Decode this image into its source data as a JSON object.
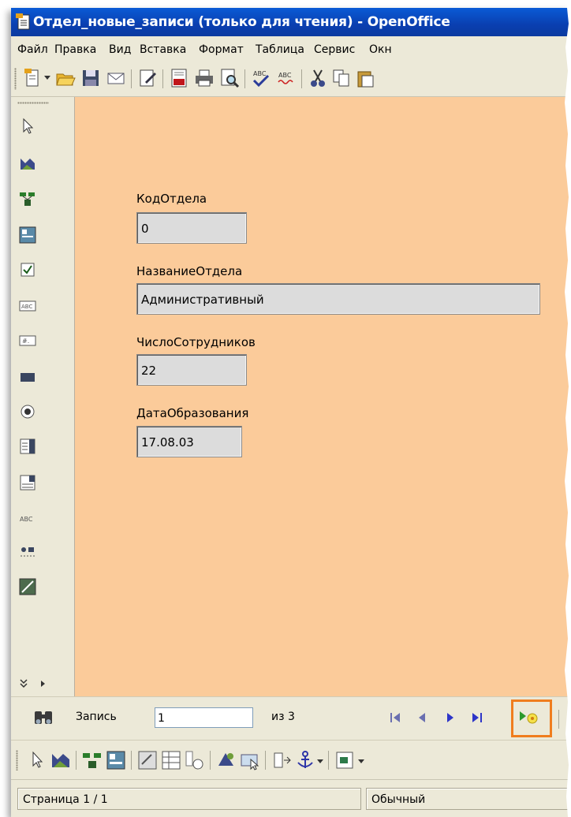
{
  "window": {
    "title": "Отдел_новые_записи (только для чтения) - OpenOffice"
  },
  "menu": {
    "items": [
      "Файл",
      "Правка",
      "Вид",
      "Вставка",
      "Формат",
      "Таблица",
      "Сервис",
      "Окн"
    ]
  },
  "toolbar": {
    "icons": [
      "new-document-icon",
      "open-folder-icon",
      "save-icon",
      "email-icon",
      "edit-file-icon",
      "export-pdf-icon",
      "print-icon",
      "print-preview-icon",
      "spellcheck-icon",
      "autospellcheck-icon",
      "cut-icon",
      "copy-icon",
      "paste-icon"
    ]
  },
  "form": {
    "fields": [
      {
        "label": "КодОтдела",
        "value": "0"
      },
      {
        "label": "НазваниеОтдела",
        "value": "Административный"
      },
      {
        "label": "ЧислоСотрудников",
        "value": "22"
      },
      {
        "label": "ДатаОбразования",
        "value": "17.08.03"
      }
    ]
  },
  "navigation": {
    "record_label": "Запись",
    "record_value": "1",
    "of_label": "из 3"
  },
  "statusbar": {
    "page": "Страница  1 / 1",
    "style": "Обычный"
  },
  "colors": {
    "form_background": "#fbcb9a",
    "highlight": "#f07d1e",
    "titlebar": "#0a4fc4"
  }
}
